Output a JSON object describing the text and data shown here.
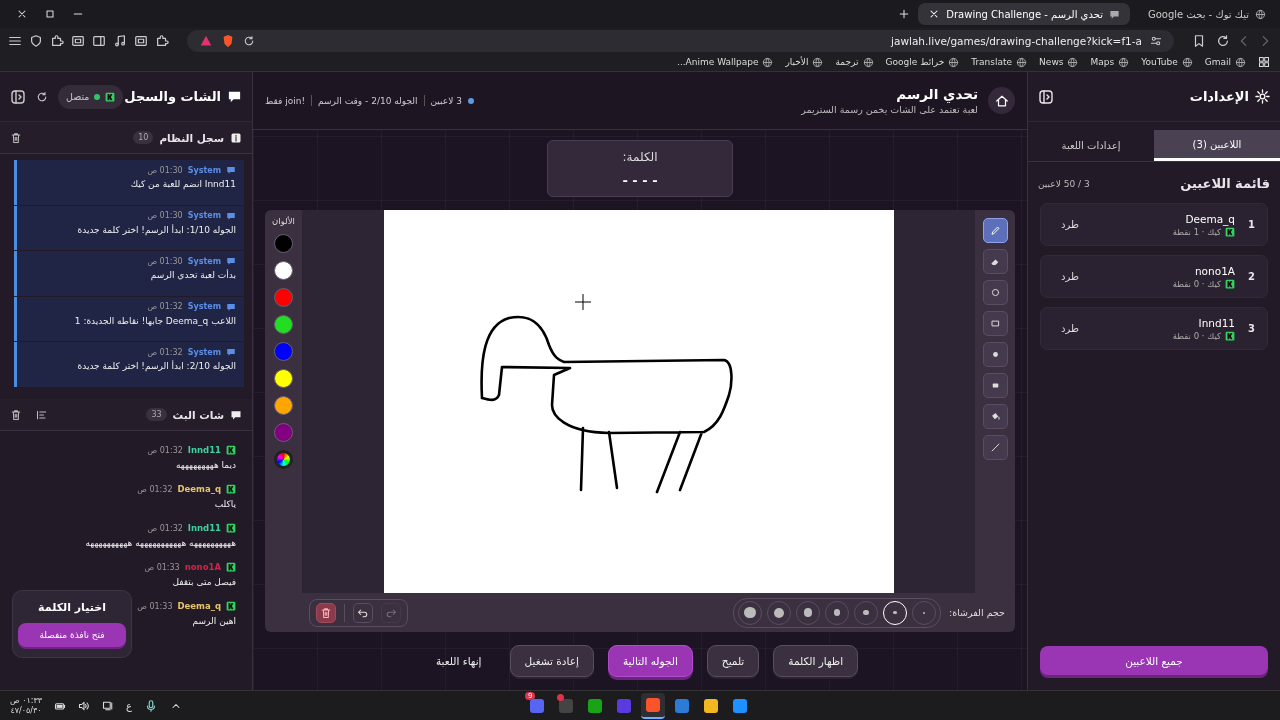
{
  "browser": {
    "tabs": [
      {
        "title": "تيك توك - بحث Google",
        "selected": false
      },
      {
        "title": "تحدي الرسم - Drawing Challenge",
        "selected": true
      }
    ],
    "url": "jawlah.live/games/drawing-challenge?kick=f1-a",
    "bookmarks": [
      "Gmail",
      "YouTube",
      "Maps",
      "News",
      "Translate",
      "خرائط Google",
      "ترجمة",
      "الأخبار",
      "Anime Wallpape..."
    ]
  },
  "settings_panel": {
    "title": "الإعدادات",
    "tabs": [
      {
        "label": "اللاعبين (3)",
        "selected": true
      },
      {
        "label": "إعدادات اللعبة",
        "selected": false
      }
    ],
    "list_title": "قائمة اللاعبين",
    "list_count": "3 / 50 لاعبين",
    "players": [
      {
        "rank": "1",
        "name": "Deema_q",
        "meta": "كيك · 1 نقطة",
        "action": "طرد"
      },
      {
        "rank": "2",
        "name": "nono1A",
        "meta": "كيك · 0 نقطة",
        "action": "طرد"
      },
      {
        "rank": "3",
        "name": "Innd11",
        "meta": "كيك · 0 نقطة",
        "action": "طرد"
      }
    ],
    "bottom_button": "جميع اللاعبين"
  },
  "game": {
    "title": "تحدي الرسم",
    "subtitle": "لعبة تعتمد على الشات يخمن رسمة الستريمر",
    "info": [
      "3 لاعبين",
      "الجوله 2/10 - وقت الرسم",
      "!join فقط"
    ],
    "word": {
      "label": "الكلمة:",
      "mask": "- - - -"
    },
    "tools": [
      {
        "kind": "pencil",
        "selected": true
      },
      {
        "kind": "eraser",
        "selected": false
      },
      {
        "kind": "circle",
        "selected": false
      },
      {
        "kind": "rect",
        "selected": false
      },
      {
        "kind": "filled-circle",
        "selected": false
      },
      {
        "kind": "filled-rect",
        "selected": false
      },
      {
        "kind": "fill",
        "selected": false
      },
      {
        "kind": "line",
        "selected": false
      }
    ],
    "colors_label": "الألوان",
    "colors": [
      {
        "color": "#000000"
      },
      {
        "color": "#ffffff"
      },
      {
        "color": "#ff0000"
      },
      {
        "color": "#22dd22"
      },
      {
        "color": "#0000ff"
      },
      {
        "color": "#ffff00"
      },
      {
        "color": "#ffa500"
      },
      {
        "color": "#800080"
      }
    ],
    "brush_label": "حجم الفرشاة:",
    "brush_sizes": [
      {
        "selected": false
      },
      {
        "selected": true
      },
      {
        "selected": false
      },
      {
        "selected": false
      },
      {
        "selected": false
      },
      {
        "selected": false
      },
      {
        "selected": false
      }
    ],
    "edit_actions": [
      {
        "kind": "clear",
        "disabled": false
      },
      {
        "kind": "undo",
        "disabled": false
      },
      {
        "kind": "redo",
        "disabled": true
      }
    ],
    "actions": [
      {
        "label": "اظهار الكلمة",
        "kind": "secondary"
      },
      {
        "label": "تلميح",
        "kind": "secondary"
      },
      {
        "label": "الجوله التالية",
        "kind": "primary"
      },
      {
        "label": "إعادة تشغيل",
        "kind": "secondary"
      },
      {
        "label": "إنهاء اللعبة",
        "kind": "text"
      }
    ]
  },
  "chat_panel": {
    "title": "الشات والسجل",
    "status": "متصل",
    "connected": true,
    "system_log": {
      "title": "سجل النظام",
      "count": "10",
      "messages": [
        {
          "user": "System",
          "time": "01:30 ص",
          "text": "Innd11 انضم للعبة من كيك"
        },
        {
          "user": "System",
          "time": "01:30 ص",
          "text": "الجوله 1/10: ابدأ الرسم! اختر كلمة جديدة"
        },
        {
          "user": "System",
          "time": "01:30 ص",
          "text": "بدأت لعبة تحدي الرسم"
        },
        {
          "user": "System",
          "time": "01:32 ص",
          "text": "اللاعب Deema_q جابها! نقاطه الجديدة: 1"
        },
        {
          "user": "System",
          "time": "01:32 ص",
          "text": "الجوله 2/10: ابدأ الرسم! اختر كلمة جديدة"
        }
      ]
    },
    "stream_chat": {
      "title": "شات البث",
      "count": "33",
      "messages": [
        {
          "user": "Innd11",
          "color": "#3fd1a0",
          "time": "01:32 ص",
          "text": "ديما هههههههههه"
        },
        {
          "user": "Deema_q",
          "color": "#e8c46a",
          "time": "01:32 ص",
          "text": "ياكلب"
        },
        {
          "user": "Innd11",
          "color": "#3fd1a0",
          "time": "01:32 ص",
          "text": "ههههههههههه هههههههههههه ههههههههههه"
        },
        {
          "user": "nono1A",
          "color": "#d0244a",
          "time": "01:33 ص",
          "text": "فيصل متى بتقفل"
        },
        {
          "user": "Deema_q",
          "color": "#e8c46a",
          "time": "01:33 ص",
          "text": "اهين الرسم"
        }
      ]
    },
    "word_picker": {
      "title": "اختيار الكلمة",
      "button": "فتح نافذة منفصلة"
    }
  },
  "taskbar": {
    "apps": [
      {
        "selected": false
      },
      {
        "selected": false
      },
      {
        "selected": false
      },
      {
        "selected": true
      },
      {
        "selected": false
      },
      {
        "selected": false
      },
      {
        "selected": false,
        "alert": true
      },
      {
        "selected": false,
        "badge": "9"
      }
    ],
    "language": "ع",
    "time": "٠١:٣٣ ص",
    "date": "٤٧/٠٥/٣٠"
  }
}
